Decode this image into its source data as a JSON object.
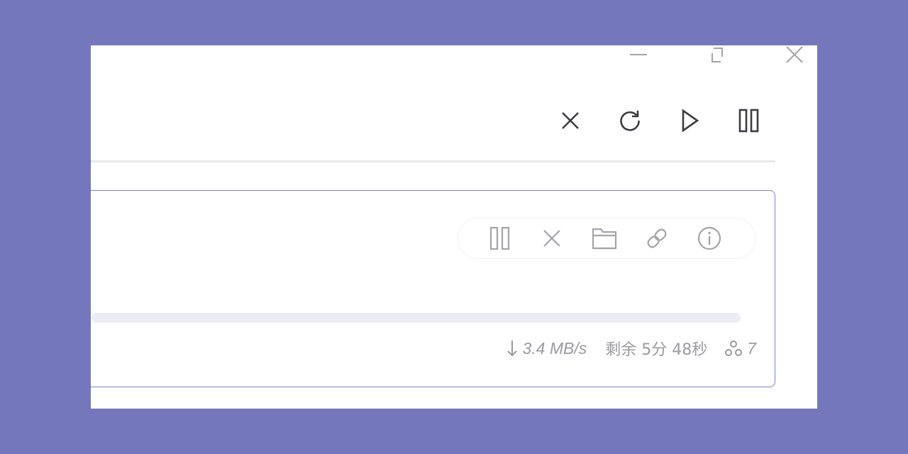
{
  "window": {
    "controls": [
      {
        "name": "minimize",
        "icon": "minimize-icon"
      },
      {
        "name": "maximize",
        "icon": "maximize-icon"
      },
      {
        "name": "close",
        "icon": "close-icon"
      }
    ]
  },
  "toolbar": {
    "buttons": [
      {
        "name": "cancel-all",
        "icon": "close-icon"
      },
      {
        "name": "refresh",
        "icon": "refresh-icon"
      },
      {
        "name": "start-all",
        "icon": "play-icon"
      },
      {
        "name": "pause-all",
        "icon": "pause-icon"
      }
    ]
  },
  "download_item": {
    "actions": [
      {
        "name": "pause",
        "icon": "pause-icon"
      },
      {
        "name": "cancel",
        "icon": "close-icon"
      },
      {
        "name": "open-folder",
        "icon": "folder-icon"
      },
      {
        "name": "copy-link",
        "icon": "link-icon"
      },
      {
        "name": "info",
        "icon": "info-icon"
      }
    ],
    "speed": "3.4 MB/s",
    "remaining": "剩余 5分 48秒",
    "peers": "7",
    "speed_icon": "arrow-down-icon",
    "peers_icon": "peers-icon"
  },
  "colors": {
    "background": "#7577bd",
    "accent_border": "#7e80cc",
    "icon_dark": "#3c3c44",
    "icon_light": "#a4a4ac",
    "text_muted": "#9a9aa3",
    "track": "#ecedf4"
  }
}
